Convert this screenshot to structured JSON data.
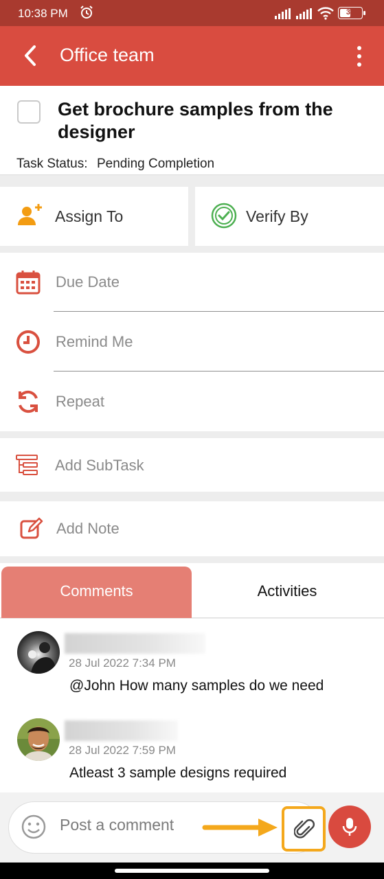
{
  "status_bar": {
    "time": "10:38 PM",
    "battery": "39",
    "icons": [
      "alarm-icon",
      "signal-icon",
      "signal-icon",
      "wifi-icon",
      "battery-icon"
    ]
  },
  "app_bar": {
    "title": "Office team",
    "icons": [
      "back-arrow-icon",
      "more-vert-icon"
    ]
  },
  "task": {
    "title": "Get brochure samples from the designer",
    "status_label": "Task Status:",
    "status_value": "Pending Completion",
    "completed": false
  },
  "assign": {
    "assign_label": "Assign To",
    "verify_label": "Verify By"
  },
  "schedule": {
    "due_date_label": "Due Date",
    "remind_label": "Remind Me",
    "repeat_label": "Repeat"
  },
  "extras": {
    "subtask_label": "Add SubTask",
    "note_label": "Add Note"
  },
  "tabs": {
    "comments": "Comments",
    "activities": "Activities",
    "active": "comments"
  },
  "comments": [
    {
      "date": "28 Jul 2022 7:34 PM",
      "text": "@John How many samples do we need"
    },
    {
      "date": "28 Jul 2022 7:59 PM",
      "text": "Atleast 3 sample designs required"
    }
  ],
  "composer": {
    "placeholder": "Post a comment"
  },
  "colors": {
    "status_bar": "#a93a2f",
    "app_bar": "#d94c40",
    "active_tab": "#e57f74",
    "icon_red": "#d9503f",
    "assign_orange": "#f39c12",
    "verify_green": "#4caf50",
    "highlight": "#f4a81c"
  }
}
